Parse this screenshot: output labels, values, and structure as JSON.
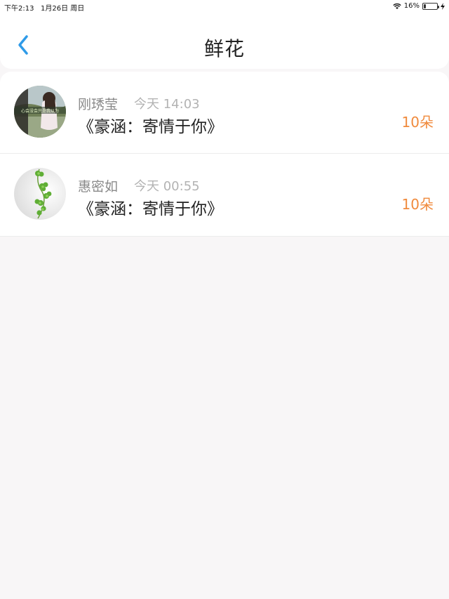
{
  "status_bar": {
    "time": "下午2:13",
    "date": "1月26日 周日",
    "battery": "16%",
    "battery_level": 0.16
  },
  "nav": {
    "title": "鲜花"
  },
  "list": [
    {
      "username": "刚琇莹",
      "time": "今天 14:03",
      "gift": "《豪涵：寄情于你》",
      "count": "10朵",
      "avatar_text": "心会没会只是我以为"
    },
    {
      "username": "惠密如",
      "time": "今天 00:55",
      "gift": "《豪涵：寄情于你》",
      "count": "10朵"
    }
  ],
  "colors": {
    "accent": "#2f9be8",
    "count": "#f08a3c",
    "background": "#f8f6f7"
  }
}
